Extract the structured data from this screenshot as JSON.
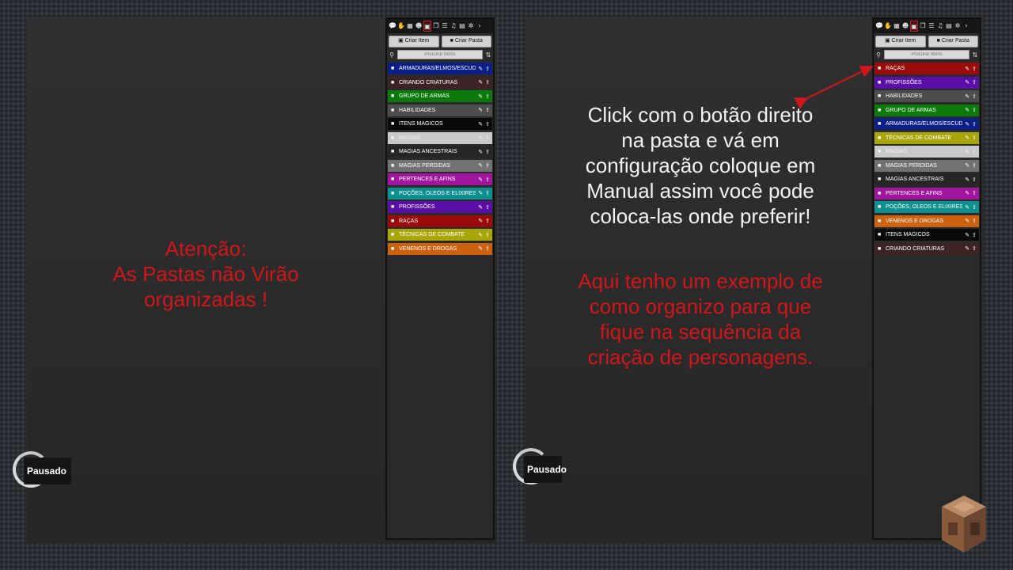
{
  "left": {
    "caption_lines": [
      "Atenção:",
      "As Pastas não Virão",
      "organizadas !"
    ],
    "paused_label": "Pausado",
    "sidebar": {
      "toolbar_icons": [
        "chat-icon",
        "hand-icon",
        "map-icon",
        "users-icon",
        "bag-icon",
        "book-icon",
        "list-icon",
        "music-icon",
        "page-icon",
        "gears-icon",
        "chevron-right-icon"
      ],
      "active_icon_index": 4,
      "create_item_label": "Criar Item",
      "create_folder_label": "Criar Pasta",
      "search_placeholder": "Procurar Items",
      "folders": [
        {
          "label": "ARMADURAS/ELMOS/ESCUDOS",
          "color": "#0b1f86"
        },
        {
          "label": "CRIANDO CRIATURAS",
          "color": "#3d2424"
        },
        {
          "label": "GRUPO DE ARMAS",
          "color": "#0b7a0b"
        },
        {
          "label": "HABILIDADES",
          "color": "#4d4d4d"
        },
        {
          "label": "ITENS MAGICOS",
          "color": "#0a0a0a"
        },
        {
          "label": "MAGIAS",
          "color": "#c9c9c9"
        },
        {
          "label": "MAGIAS ANCESTRAIS",
          "color": "#262626"
        },
        {
          "label": "MAGIAS PERDIDAS",
          "color": "#727272"
        },
        {
          "label": "PERTENCES E AFINS",
          "color": "#a0179e"
        },
        {
          "label": "POÇÕES, OLEOS E ELIXIRES",
          "color": "#0f8f8f"
        },
        {
          "label": "PROFISSÕES",
          "color": "#5a0fa6"
        },
        {
          "label": "RAÇAS",
          "color": "#9a0c0c"
        },
        {
          "label": "TÉCNICAS DE COMBATE",
          "color": "#a9a60c"
        },
        {
          "label": "VENENOS E DROGAS",
          "color": "#cc6110"
        }
      ]
    }
  },
  "right": {
    "instruction_lines": [
      "Click com o botão direito",
      "na pasta e vá em",
      "configuração coloque em",
      "Manual assim você pode",
      "coloca-las onde preferir!"
    ],
    "example_lines": [
      "Aqui tenho um exemplo de",
      "como organizo para que",
      "fique na sequência da",
      "criação de personagens."
    ],
    "paused_label": "Pausado",
    "sidebar": {
      "toolbar_icons": [
        "chat-icon",
        "hand-icon",
        "map-icon",
        "users-icon",
        "bag-icon",
        "book-icon",
        "list-icon",
        "music-icon",
        "page-icon",
        "gears-icon",
        "chevron-right-icon"
      ],
      "active_icon_index": 4,
      "create_item_label": "Criar Item",
      "create_folder_label": "Criar Pasta",
      "search_placeholder": "Procurar Items",
      "folders": [
        {
          "label": "RAÇAS",
          "color": "#9a0c0c"
        },
        {
          "label": "PROFISSÕES",
          "color": "#5a0fa6"
        },
        {
          "label": "HABILIDADES",
          "color": "#4d4d4d"
        },
        {
          "label": "GRUPO DE ARMAS",
          "color": "#0b7a0b"
        },
        {
          "label": "ARMADURAS/ELMOS/ESCUDOS",
          "color": "#0b1f86"
        },
        {
          "label": "TÉCNICAS DE COMBATE",
          "color": "#a9a60c"
        },
        {
          "label": "MAGIAS",
          "color": "#c9c9c9"
        },
        {
          "label": "MAGIAS PERDIDAS",
          "color": "#727272"
        },
        {
          "label": "MAGIAS ANCESTRAIS",
          "color": "#262626"
        },
        {
          "label": "PERTENCES E AFINS",
          "color": "#a0179e"
        },
        {
          "label": "POÇÕES, OLEOS E ELIXIRES",
          "color": "#0f8f8f"
        },
        {
          "label": "VENENOS E DROGAS",
          "color": "#cc6110"
        },
        {
          "label": "ITENS MAGICOS",
          "color": "#0a0a0a"
        },
        {
          "label": "CRIANDO CRIATURAS",
          "color": "#3d2424"
        }
      ]
    }
  }
}
